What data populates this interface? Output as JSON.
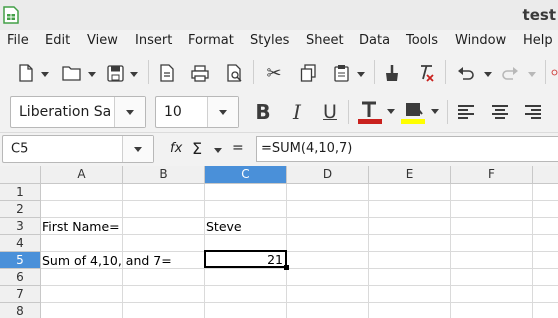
{
  "window": {
    "title": "test"
  },
  "menu": [
    "File",
    "Edit",
    "View",
    "Insert",
    "Format",
    "Styles",
    "Sheet",
    "Data",
    "Tools",
    "Window",
    "Help"
  ],
  "toolbar2": {
    "font_name": "Liberation Sa",
    "font_size": "10"
  },
  "formula_bar": {
    "name_box": "C5",
    "function_wizard": "fx",
    "sum_symbol": "Σ",
    "equals_symbol": "=",
    "formula": "=SUM(4,10,7)"
  },
  "sheet": {
    "columns": [
      "A",
      "B",
      "C",
      "D",
      "E",
      "F"
    ],
    "rows": [
      "1",
      "2",
      "3",
      "4",
      "5",
      "6",
      "7",
      "8"
    ],
    "active_cell": {
      "column": "C",
      "row": "5"
    },
    "cells": {
      "A3": "First Name=",
      "C3": "Steve",
      "A5": "Sum of 4,10, and 7=",
      "C5": "21"
    }
  },
  "colors": {
    "accent": "#4a90d9",
    "font_color_bar": "#c9211e",
    "highlight_bar": "#ffff00"
  }
}
